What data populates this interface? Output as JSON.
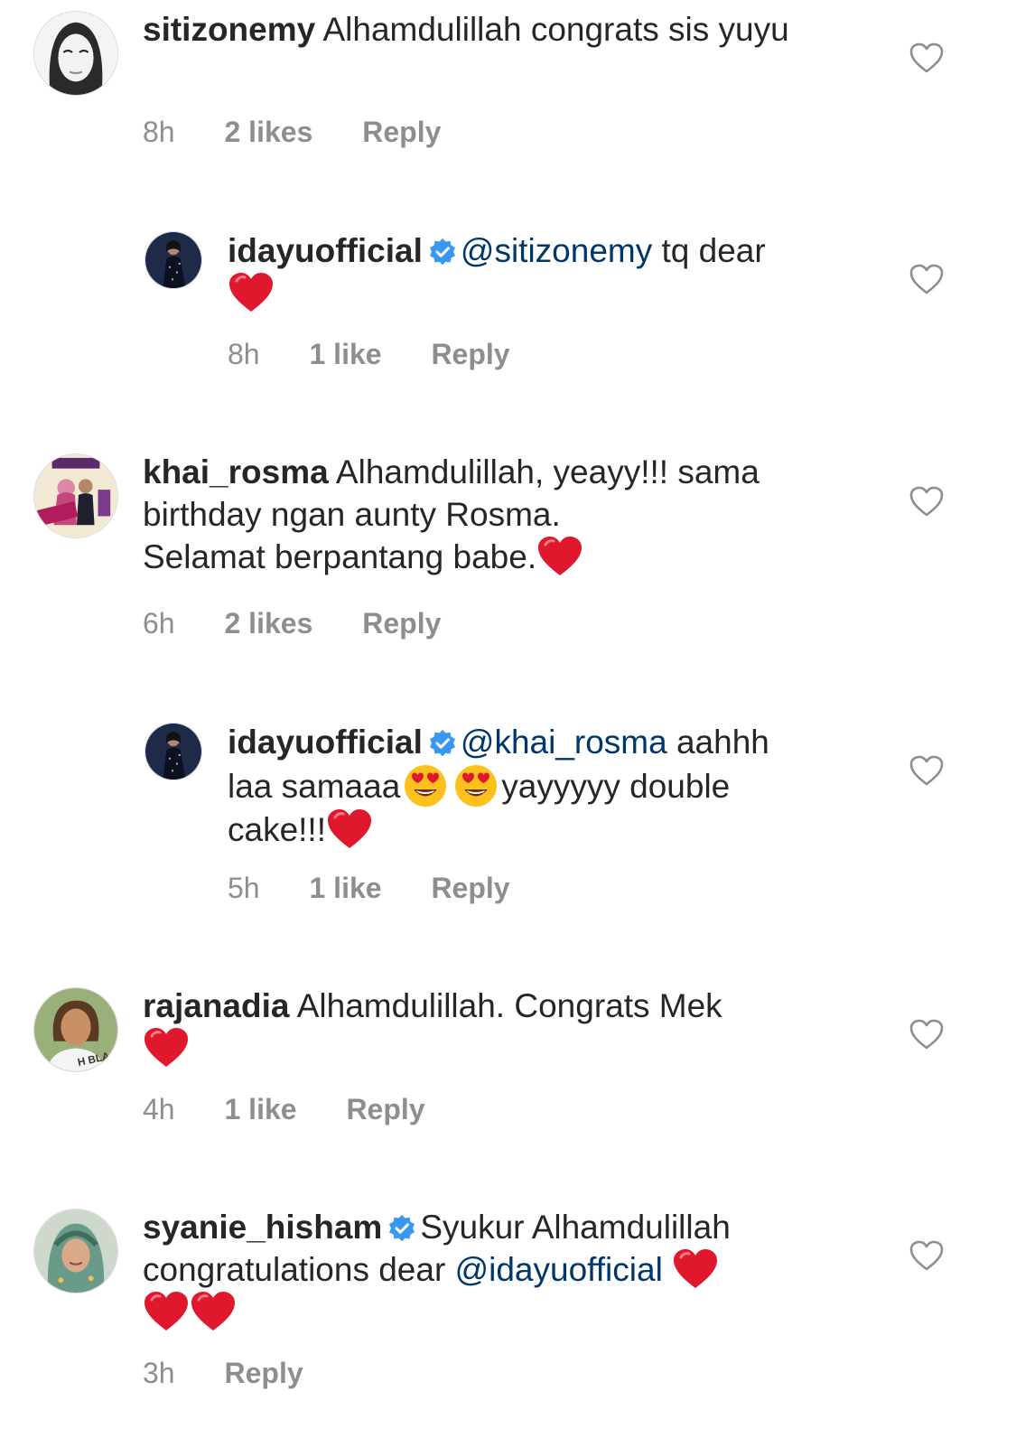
{
  "comments": [
    {
      "username": "sitizonemy",
      "text": "Alhamdulillah congrats sis yuyu",
      "time": "8h",
      "likes": "2 likes",
      "reply": "Reply",
      "avatar_icon": "user-avatar-woman-sketch"
    },
    {
      "username": "idayuofficial",
      "verified": true,
      "mention": "@sitizonemy",
      "text": "tq dear",
      "time": "8h",
      "likes": "1 like",
      "reply": "Reply",
      "avatar_icon": "user-avatar-singer"
    },
    {
      "username": "khai_rosma",
      "text_line1": "Alhamdulillah, yeayy!!! sama",
      "text_line2": "birthday ngan aunty Rosma.",
      "text_line3": "Selamat berpantang babe.",
      "time": "6h",
      "likes": "2 likes",
      "reply": "Reply",
      "avatar_icon": "user-avatar-product-ad"
    },
    {
      "username": "idayuofficial",
      "verified": true,
      "mention": "@khai_rosma",
      "text_a": "aahhh",
      "text_b": "laa samaaa",
      "text_c": "yayyyyy double",
      "text_d": "cake!!!",
      "time": "5h",
      "likes": "1 like",
      "reply": "Reply",
      "avatar_icon": "user-avatar-singer"
    },
    {
      "username": "rajanadia",
      "text": "Alhamdulillah. Congrats Mek",
      "time": "4h",
      "likes": "1 like",
      "reply": "Reply",
      "avatar_icon": "user-avatar-woman"
    },
    {
      "username": "syanie_hisham",
      "verified": true,
      "text_line1": "Syukur Alhamdulillah",
      "text_line2": "congratulations dear",
      "mention": "@idayuofficial",
      "time": "3h",
      "reply": "Reply",
      "avatar_icon": "user-avatar-hijab"
    }
  ],
  "colors": {
    "text": "#262626",
    "meta": "#8e8e8e",
    "mention": "#00376b",
    "verified": "#3897f0",
    "heart": "#e0182d"
  }
}
